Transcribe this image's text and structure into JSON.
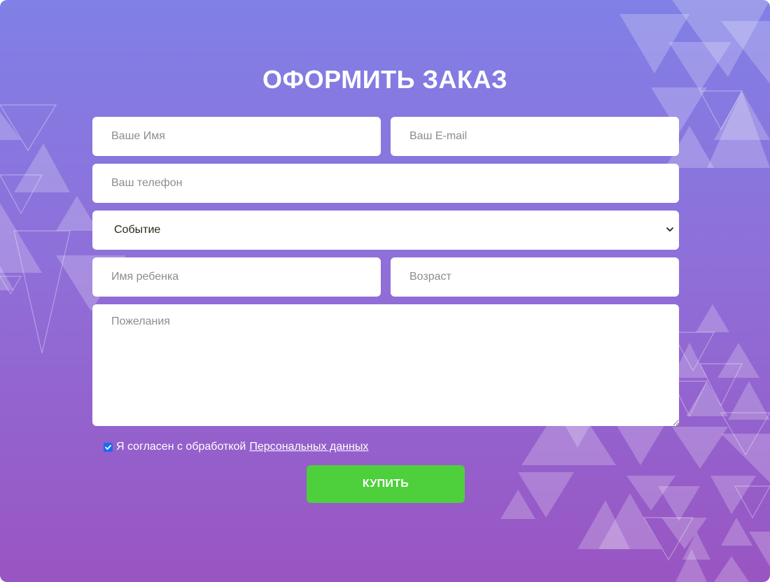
{
  "form": {
    "title": "ОФОРМИТЬ ЗАКАЗ",
    "name_placeholder": "Ваше Имя",
    "email_placeholder": "Ваш E-mail",
    "phone_placeholder": "Ваш телефон",
    "event_selected": "Событие",
    "child_name_placeholder": "Имя ребенка",
    "age_placeholder": "Возраст",
    "wishes_placeholder": "Пожелания",
    "consent_checked": true,
    "consent_text": "Я согласен с обработкой",
    "consent_link": "Персональных данных",
    "submit_label": "КУПИТЬ"
  },
  "colors": {
    "background_top": "#8080e6",
    "background_bottom": "#9955c2",
    "submit": "#4ecf3c",
    "checkbox": "#1a6bf0"
  },
  "icons": [
    "chevron-down-icon",
    "check-icon",
    "resize-grip-icon"
  ]
}
